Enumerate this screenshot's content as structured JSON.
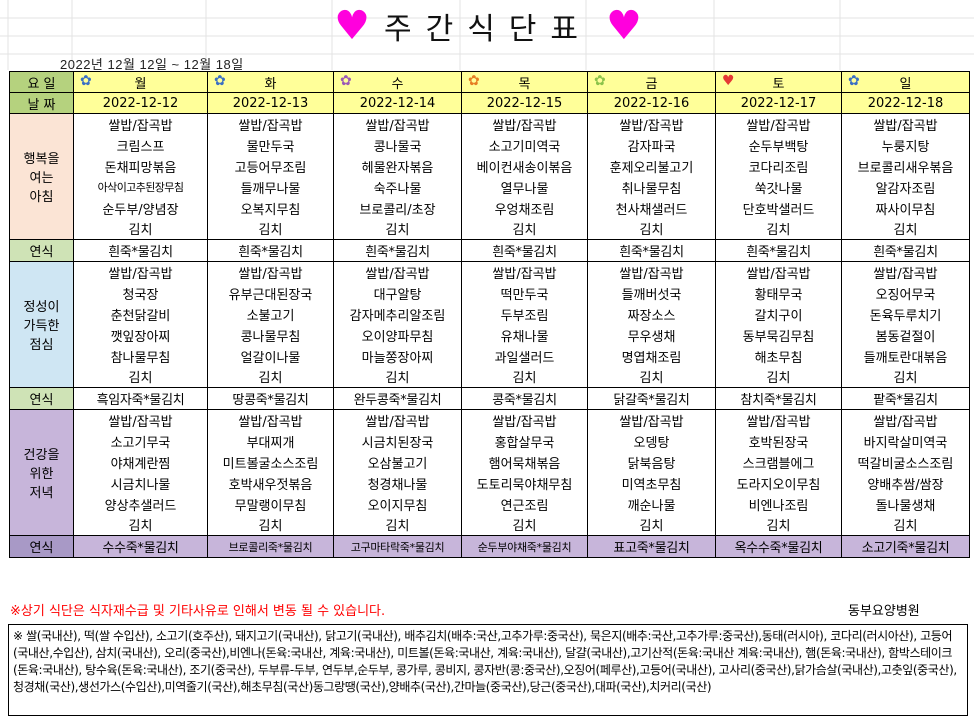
{
  "title": "주간식단표",
  "title_letters": [
    "주",
    "간",
    "식",
    "단",
    "표"
  ],
  "date_range": "2022년 12월 12일 ~ 12월 18일",
  "header": {
    "row_label_1": "요 일",
    "row_label_2": "날 짜",
    "days": [
      {
        "day": "월",
        "date": "2022-12-12",
        "icon": "flower-icon",
        "icon_color": "#3a6fc4"
      },
      {
        "day": "화",
        "date": "2022-12-13",
        "icon": "flower-icon",
        "icon_color": "#3a6fc4"
      },
      {
        "day": "수",
        "date": "2022-12-14",
        "icon": "flower-icon",
        "icon_color": "#9b59b6"
      },
      {
        "day": "목",
        "date": "2022-12-15",
        "icon": "flower-icon",
        "icon_color": "#e67e22"
      },
      {
        "day": "금",
        "date": "2022-12-16",
        "icon": "flower-icon",
        "icon_color": "#8bc34a"
      },
      {
        "day": "토",
        "date": "2022-12-17",
        "icon": "heart-icon",
        "icon_color": "#e53935"
      },
      {
        "day": "일",
        "date": "2022-12-18",
        "icon": "flower-icon",
        "icon_color": "#3a6fc4"
      }
    ]
  },
  "sections": {
    "breakfast": {
      "label": [
        "행복을",
        "여는",
        "아침"
      ],
      "rows": [
        [
          "쌀밥/잡곡밥",
          "쌀밥/잡곡밥",
          "쌀밥/잡곡밥",
          "쌀밥/잡곡밥",
          "쌀밥/잡곡밥",
          "쌀밥/잡곡밥",
          "쌀밥/잡곡밥"
        ],
        [
          "크림스프",
          "물만두국",
          "콩나물국",
          "소고기미역국",
          "감자파국",
          "순두부백탕",
          "누룽지탕"
        ],
        [
          "돈채피망볶음",
          "고등어무조림",
          "헤물완자볶음",
          "베이컨새송이볶음",
          "훈제오리불고기",
          "코다리조림",
          "브로콜리새우볶음"
        ],
        [
          "아삭이고추된장무침",
          "들깨무나물",
          "숙주나물",
          "열무나물",
          "취나물무침",
          "쑥갓나물",
          "알감자조림"
        ],
        [
          "순두부/양념장",
          "오복지무침",
          "브로콜리/초장",
          "우엉채조림",
          "천사채샐러드",
          "단호박샐러드",
          "짜사이무침"
        ],
        [
          "김치",
          "김치",
          "김치",
          "김치",
          "김치",
          "김치",
          "김치"
        ]
      ],
      "snack_label": "연식",
      "snacks": [
        "흰죽*물김치",
        "흰죽*물김치",
        "흰죽*물김치",
        "흰죽*물김치",
        "흰죽*물김치",
        "흰죽*물김치",
        "흰죽*물김치"
      ]
    },
    "lunch": {
      "label": [
        "정성이",
        "가득한",
        "점심"
      ],
      "rows": [
        [
          "쌀밥/잡곡밥",
          "쌀밥/잡곡밥",
          "쌀밥/잡곡밥",
          "쌀밥/잡곡밥",
          "쌀밥/잡곡밥",
          "쌀밥/잡곡밥",
          "쌀밥/잡곡밥"
        ],
        [
          "청국장",
          "유부근대된장국",
          "대구알탕",
          "떡만두국",
          "들깨버섯국",
          "황태무국",
          "오징어무국"
        ],
        [
          "춘천닭갈비",
          "소불고기",
          "감자메추리알조림",
          "두부조림",
          "짜장소스",
          "갈치구이",
          "돈육두루치기"
        ],
        [
          "깻잎장아찌",
          "콩나물무침",
          "오이양파무침",
          "유채나물",
          "무우생채",
          "동부묵김무침",
          "봄동겉절이"
        ],
        [
          "참나물무침",
          "얼갈이나물",
          "마늘쫑장아찌",
          "과일샐러드",
          "명엽채조림",
          "해초무침",
          "들깨토란대볶음"
        ],
        [
          "김치",
          "김치",
          "김치",
          "김치",
          "김치",
          "김치",
          "김치"
        ]
      ],
      "snack_label": "연식",
      "snacks": [
        "흑임자죽*물김치",
        "땅콩죽*물김치",
        "완두콩죽*물김치",
        "콩죽*물김치",
        "닭갈죽*물김치",
        "참치죽*물김치",
        "팥죽*물김치"
      ]
    },
    "dinner": {
      "label": [
        "건강을",
        "위한",
        "저녁"
      ],
      "rows": [
        [
          "쌀밥/잡곡밥",
          "쌀밥/잡곡밥",
          "쌀밥/잡곡밥",
          "쌀밥/잡곡밥",
          "쌀밥/잡곡밥",
          "쌀밥/잡곡밥",
          "쌀밥/잡곡밥"
        ],
        [
          "소고기무국",
          "부대찌개",
          "시금치된장국",
          "홍합살무국",
          "오뎅탕",
          "호박된장국",
          "바지락살미역국"
        ],
        [
          "야채계란찜",
          "미트볼굴소스조림",
          "오삼불고기",
          "햄어묵채볶음",
          "닭북음탕",
          "스크램블에그",
          "떡갈비굴소스조림"
        ],
        [
          "시금치나물",
          "호박새우젓볶음",
          "청경채나물",
          "도토리묵야채무침",
          "미역초무침",
          "도라지오이무침",
          "양배추쌈/쌈장"
        ],
        [
          "양상추샐러드",
          "무말랭이무침",
          "오이지무침",
          "연근조림",
          "깨순나물",
          "비엔나조림",
          "돌나물생채"
        ],
        [
          "김치",
          "김치",
          "김치",
          "김치",
          "김치",
          "김치",
          "김치"
        ]
      ],
      "snack_label": "연식",
      "snacks": [
        "수수죽*물김치",
        "브로콜리죽*물김치",
        "고구마타락죽*물김치",
        "순두부야채죽*물김치",
        "표고죽*물김치",
        "옥수수죽*물김치",
        "소고기죽*물김치"
      ]
    }
  },
  "notice": "※상기 식단은 식자재수급 및 기타사유로 인해서 변동 될 수 있습니다.",
  "hospital": "동부요양병원",
  "origin": "※ 쌀(국내산), 떡(쌀 수입산), 소고기(호주산), 돼지고기(국내산), 닭고기(국내산), 배추김치(배추:국산,고추가루:중국산), 묵은지(배추:국산,고추가루:중국산),동태(러시아), 코다리(러시아산), 고등어(국내산,수입산), 삼치(국내산), 오리(중국산),비엔나(돈육:국내산, 계육:국내산), 미트볼(돈육:국내산, 계육:국내산), 달걀(국내산),고기산적(돈육:국내산 계육:국내산), 햄(돈육:국내산), 함박스테이크(돈육:국내산), 탕수육(돈육:국내산), 조기(중국산), 두부류-두부, 연두부,순두부, 콩가루, 콩비지, 콩자반(콩:중국산),오징어(페루산),고등어(국내산), 고사리(중국산),닭가슴살(국내산),고춧잎(중국산),청경채(국산),생선가스(수입산),미역줄기(국산),해초무침(국산)동그랑땡(국산),양배추(국산),간마늘(중국산),당근(중국산),대파(국산),치커리(국산)",
  "colors": {
    "heart": "#ff00dd",
    "header_left": "#b5d27e",
    "header_days": "#ffff99",
    "breakfast": "#fbe4d5",
    "lunch": "#cfe6f3",
    "dinner": "#c7b5da",
    "snack_label": "#cfe3b6",
    "notice": "#ff0000"
  }
}
